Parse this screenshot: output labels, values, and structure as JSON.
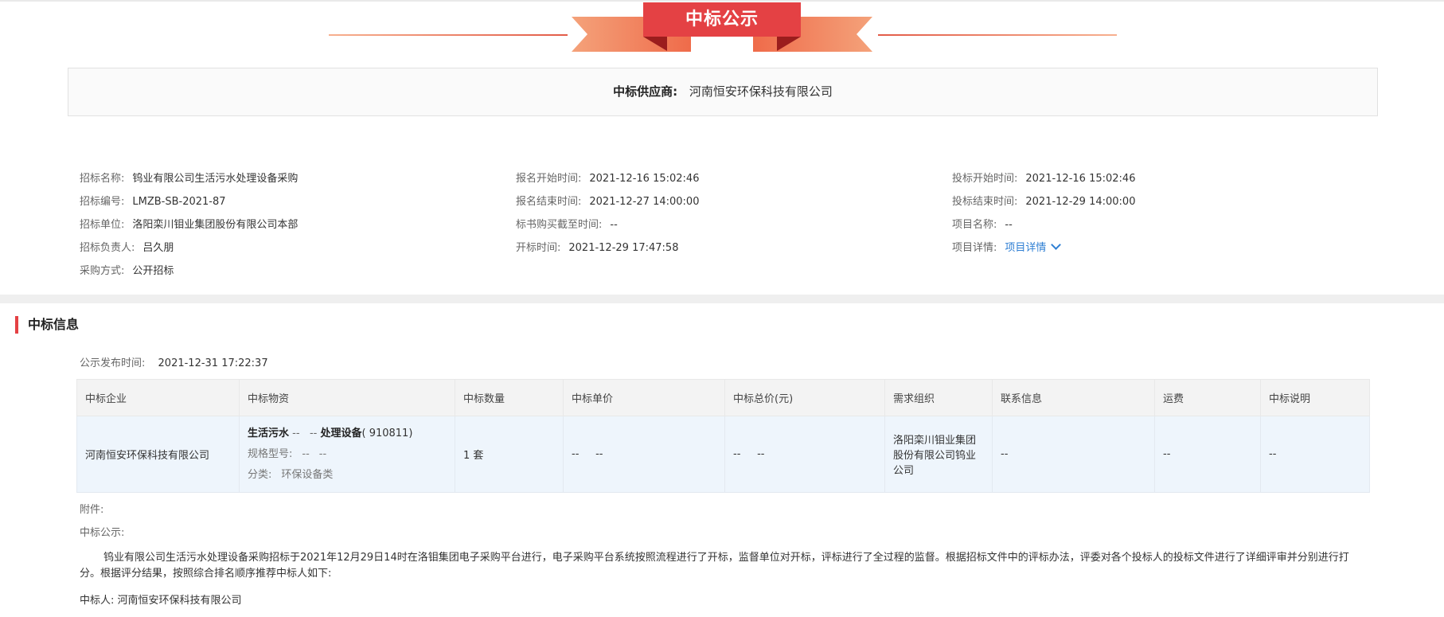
{
  "header": {
    "title": "中标公示"
  },
  "supplier": {
    "label": "中标供应商:",
    "name": "河南恒安环保科技有限公司"
  },
  "info": {
    "col1": [
      {
        "key": "招标名称:",
        "value": "钨业有限公司生活污水处理设备采购"
      },
      {
        "key": "招标编号:",
        "value": "LMZB-SB-2021-87"
      },
      {
        "key": "招标单位:",
        "value": "洛阳栾川钼业集团股份有限公司本部"
      },
      {
        "key": "招标负责人:",
        "value": "吕久朋"
      },
      {
        "key": "采购方式:",
        "value": "公开招标"
      }
    ],
    "col2": [
      {
        "key": "报名开始时间:",
        "value": "2021-12-16 15:02:46"
      },
      {
        "key": "报名结束时间:",
        "value": "2021-12-27 14:00:00"
      },
      {
        "key": "标书购买截至时间:",
        "value": "--"
      },
      {
        "key": "开标时间:",
        "value": "2021-12-29 17:47:58"
      }
    ],
    "col3": [
      {
        "key": "投标开始时间:",
        "value": "2021-12-16 15:02:46"
      },
      {
        "key": "投标结束时间:",
        "value": "2021-12-29 14:00:00"
      },
      {
        "key": "项目名称:",
        "value": "--"
      },
      {
        "key": "项目详情:",
        "value": "项目详情"
      }
    ]
  },
  "section": {
    "title": "中标信息"
  },
  "publish": {
    "label": "公示发布时间:",
    "value": "2021-12-31 17:22:37"
  },
  "table": {
    "headers": [
      "中标企业",
      "中标物资",
      "中标数量",
      "中标单价",
      "中标总价(元)",
      "需求组织",
      "联系信息",
      "运费",
      "中标说明"
    ],
    "row": {
      "company": "河南恒安环保科技有限公司",
      "material": {
        "name1": "生活污水",
        "dash1": "--",
        "dash2": "--",
        "name2": "处理设备",
        "code": "( 910811)",
        "spec_label": "规格型号:",
        "spec_v1": "--",
        "spec_v2": "--",
        "cat_label": "分类:",
        "cat_value": "环保设备类"
      },
      "quantity": "1 套",
      "unit_price_a": "--",
      "unit_price_b": "--",
      "total_a": "--",
      "total_b": "--",
      "org": "洛阳栾川钼业集团股份有限公司钨业公司",
      "contact": "--",
      "freight": "--",
      "note": "--"
    }
  },
  "attachments": {
    "label": "附件:"
  },
  "announcement": {
    "label": "中标公示:",
    "text": "钨业有限公司生活污水处理设备采购招标于2021年12月29日14时在洛钼集团电子采购平台进行，电子采购平台系统按照流程进行了开标，监督单位对开标，评标进行了全过程的监督。根据招标文件中的评标办法，评委对各个投标人的投标文件进行了详细评审并分别进行打分。根据评分结果，按照综合排名顺序推荐中标人如下:",
    "winner": "中标人: 河南恒安环保科技有限公司"
  },
  "colors": {
    "accent": "#e44144",
    "link": "#2f7fd3"
  }
}
